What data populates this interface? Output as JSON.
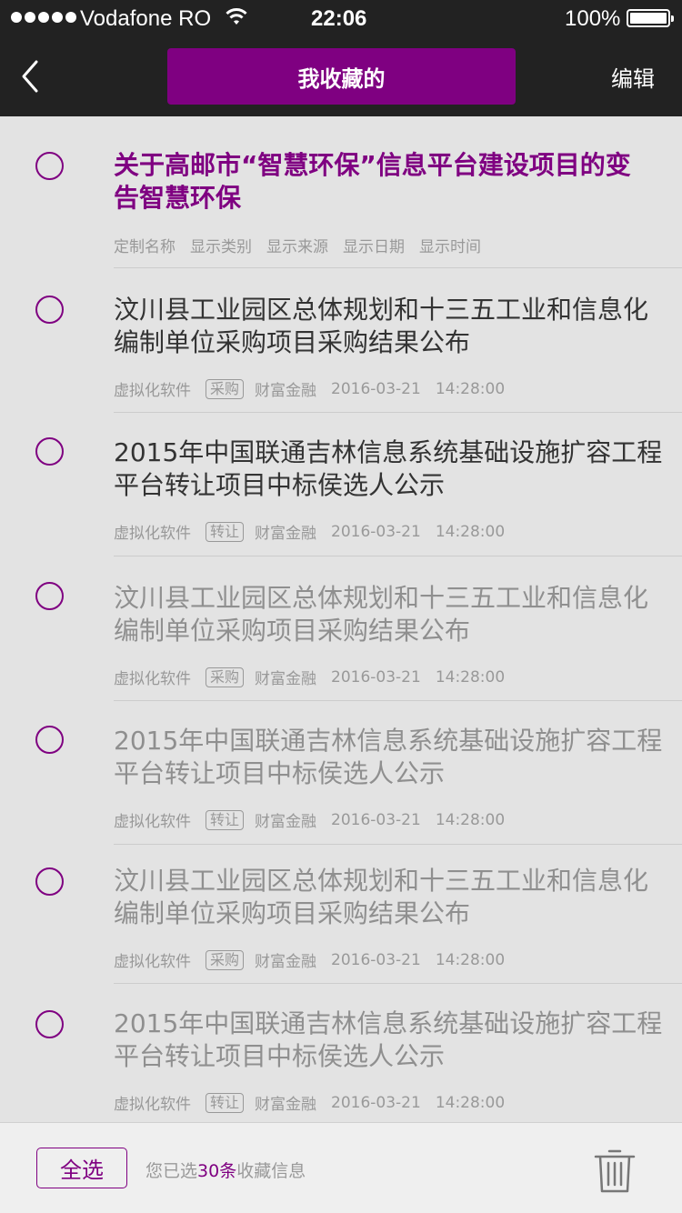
{
  "status_bar": {
    "carrier": "Vodafone RO",
    "time": "22:06",
    "battery": "100%"
  },
  "nav": {
    "title": "我收藏的",
    "edit_label": "编辑"
  },
  "items": [
    {
      "title_line1": "关于高邮市“智慧环保”信息平台建设项目的变",
      "title_line2": "告智慧环保",
      "meta": [
        "定制名称",
        "显示类别",
        "显示来源",
        "显示日期",
        "显示时间"
      ]
    },
    {
      "title_line1": "汶川县工业园区总体规划和十三五工业和信息化",
      "title_line2": "编制单位采购项目采购结果公布",
      "category": "虚拟化软件",
      "tag": "采购",
      "source": "财富金融",
      "date": "2016-03-21",
      "time": "14:28:00"
    },
    {
      "title_line1": "2015年中国联通吉林信息系统基础设施扩容工程",
      "title_line2": "平台转让项目中标侯选人公示",
      "category": "虚拟化软件",
      "tag": "转让",
      "source": "财富金融",
      "date": "2016-03-21",
      "time": "14:28:00"
    },
    {
      "title_line1": "汶川县工业园区总体规划和十三五工业和信息化",
      "title_line2": "编制单位采购项目采购结果公布",
      "category": "虚拟化软件",
      "tag": "采购",
      "source": "财富金融",
      "date": "2016-03-21",
      "time": "14:28:00"
    },
    {
      "title_line1": "2015年中国联通吉林信息系统基础设施扩容工程",
      "title_line2": "平台转让项目中标侯选人公示",
      "category": "虚拟化软件",
      "tag": "转让",
      "source": "财富金融",
      "date": "2016-03-21",
      "time": "14:28:00"
    },
    {
      "title_line1": "汶川县工业园区总体规划和十三五工业和信息化",
      "title_line2": "编制单位采购项目采购结果公布",
      "category": "虚拟化软件",
      "tag": "采购",
      "source": "财富金融",
      "date": "2016-03-21",
      "time": "14:28:00"
    },
    {
      "title_line1": "2015年中国联通吉林信息系统基础设施扩容工程",
      "title_line2": "平台转让项目中标侯选人公示",
      "category": "虚拟化软件",
      "tag": "转让",
      "source": "财富金融",
      "date": "2016-03-21",
      "time": "14:28:00"
    }
  ],
  "footer": {
    "select_all_label": "全选",
    "info_prefix": "您已选",
    "info_count": "30条",
    "info_suffix": "收藏信息"
  },
  "colors": {
    "accent": "#7f0081",
    "header_bg": "#222222",
    "list_bg": "#e3e3e3"
  }
}
